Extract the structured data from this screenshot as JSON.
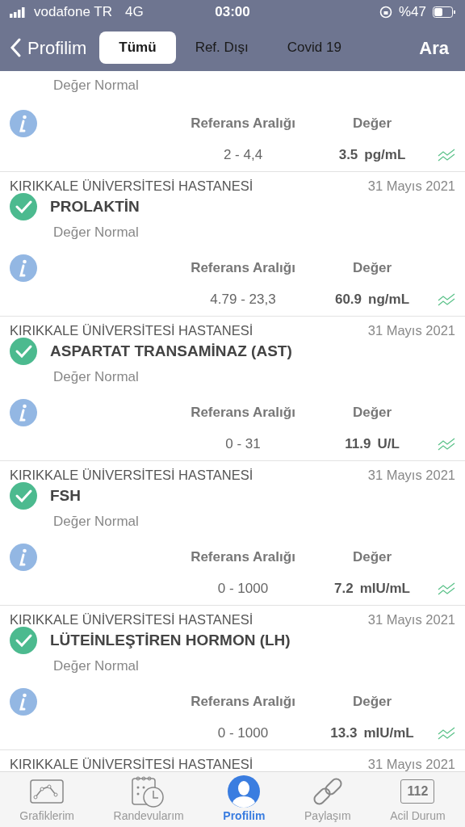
{
  "status_bar": {
    "carrier": "vodafone TR",
    "network": "4G",
    "time": "03:00",
    "battery": "%47"
  },
  "nav": {
    "back": "Profilim",
    "tabs": [
      {
        "label": "Tümü",
        "selected": true
      },
      {
        "label": "Ref. Dışı",
        "selected": false
      },
      {
        "label": "Covid 19",
        "selected": false
      }
    ],
    "action": "Ara"
  },
  "results": [
    {
      "kind": "partial",
      "status": "Değer Normal",
      "ok": true,
      "range_label": "Referans Aralığı",
      "value_label": "Değer",
      "range": "2 - 4,4",
      "value": "3.5",
      "unit": "pg/mL"
    },
    {
      "kind": "full",
      "hospital": "KIRIKKALE ÜNİVERSİTESİ HASTANESİ",
      "date": "31 Mayıs 2021",
      "name": "PROLAKTİN",
      "status": "Değer Normal",
      "ok": true,
      "range_label": "Referans Aralığı",
      "value_label": "Değer",
      "range": "4.79 - 23,3",
      "value": "60.9",
      "unit": "ng/mL"
    },
    {
      "kind": "full",
      "hospital": "KIRIKKALE ÜNİVERSİTESİ HASTANESİ",
      "date": "31 Mayıs 2021",
      "name": "ASPARTAT TRANSAMİNAZ (AST)",
      "status": "Değer Normal",
      "ok": true,
      "range_label": "Referans Aralığı",
      "value_label": "Değer",
      "range": "0 - 31",
      "value": "11.9",
      "unit": "U/L"
    },
    {
      "kind": "full",
      "hospital": "KIRIKKALE ÜNİVERSİTESİ HASTANESİ",
      "date": "31 Mayıs 2021",
      "name": "FSH",
      "status": "Değer Normal",
      "ok": true,
      "range_label": "Referans Aralığı",
      "value_label": "Değer",
      "range": "0 - 1000",
      "value": "7.2",
      "unit": "mIU/mL"
    },
    {
      "kind": "full",
      "hospital": "KIRIKKALE ÜNİVERSİTESİ HASTANESİ",
      "date": "31 Mayıs 2021",
      "name": "LÜTEİNLEŞTİREN HORMON (LH)",
      "status": "Değer Normal",
      "ok": true,
      "range_label": "Referans Aralığı",
      "value_label": "Değer",
      "range": "0 - 1000",
      "value": "13.3",
      "unit": "mIU/mL"
    },
    {
      "kind": "header",
      "hospital": "KIRIKKALE ÜNİVERSİTESİ HASTANESİ",
      "date": "31 Mayıs 2021"
    }
  ],
  "tab_bar": [
    {
      "label": "Grafiklerim",
      "kind": "chart",
      "selected": false
    },
    {
      "label": "Randevularım",
      "kind": "calendar",
      "selected": false
    },
    {
      "label": "Profilim",
      "kind": "person",
      "selected": true
    },
    {
      "label": "Paylaşım",
      "kind": "link",
      "selected": false
    },
    {
      "label": "Acil Durum",
      "kind": "emergency",
      "code": "112",
      "selected": false
    }
  ]
}
